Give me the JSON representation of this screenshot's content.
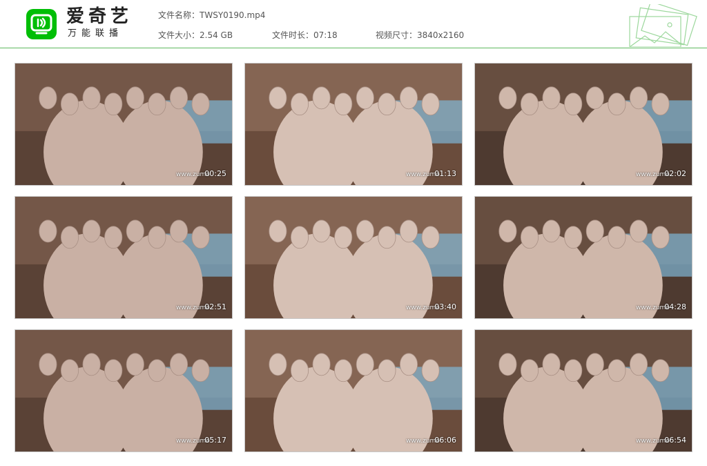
{
  "header": {
    "logo_icon": "iqiyi-tv-icon",
    "brand_title": "爱奇艺",
    "brand_subtitle": "万能联播",
    "file_name": "文件名称：TWSY0190.mp4",
    "file_size": "文件大小：2.54 GB",
    "duration": "文件时长：07:18",
    "resolution": "视频尺寸：3840x2160",
    "decoration_icon": "photo-stack-icon"
  },
  "colors": {
    "brand_green": "#00be06",
    "divider_green": "#5cb85c"
  },
  "thumbnails": [
    {
      "timestamp": "00:25",
      "watermark": "www.zumo"
    },
    {
      "timestamp": "01:13",
      "watermark": "www.zumo"
    },
    {
      "timestamp": "02:02",
      "watermark": "www.zumo"
    },
    {
      "timestamp": "02:51",
      "watermark": "www.zumo"
    },
    {
      "timestamp": "03:40",
      "watermark": "www.zumo"
    },
    {
      "timestamp": "04:28",
      "watermark": "www.zumo"
    },
    {
      "timestamp": "05:17",
      "watermark": "www.zumo"
    },
    {
      "timestamp": "06:06",
      "watermark": "www.zumo"
    },
    {
      "timestamp": "06:54",
      "watermark": "www.zumo"
    }
  ]
}
